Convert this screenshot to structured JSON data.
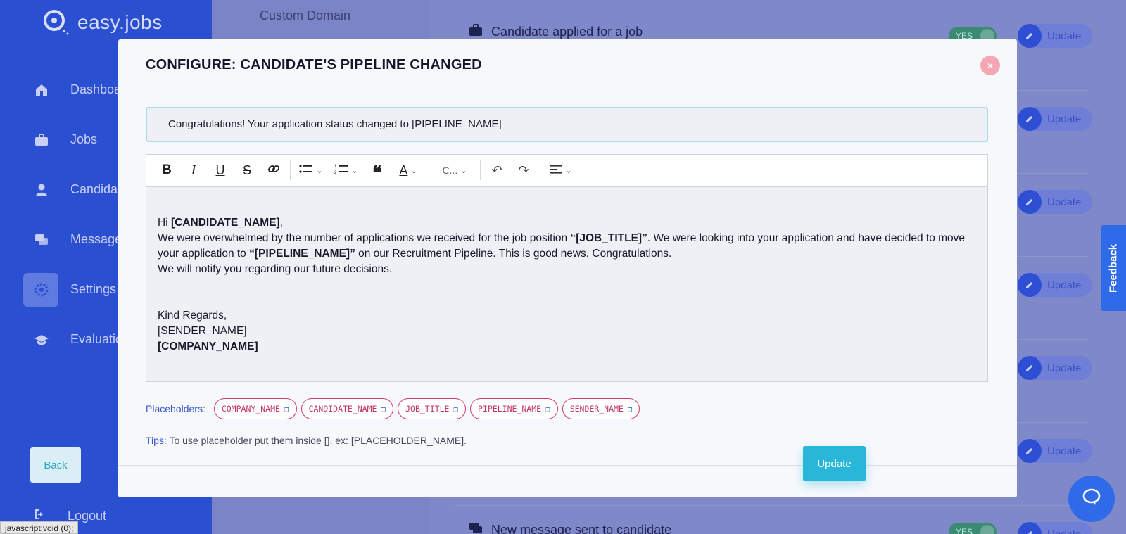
{
  "app": {
    "logo_text": "easy.jobs"
  },
  "sidebar": {
    "items": [
      {
        "label": "Dashboard",
        "icon": "home-icon"
      },
      {
        "label": "Jobs",
        "icon": "briefcase-icon"
      },
      {
        "label": "Candidates",
        "icon": "user-icon"
      },
      {
        "label": "Messages",
        "icon": "chat-icon"
      },
      {
        "label": "Settings",
        "icon": "gear-icon",
        "active": true
      },
      {
        "label": "Evaluation",
        "icon": "graduation-cap-icon"
      }
    ],
    "logout": "Logout"
  },
  "settings_menu": {
    "custom_domain": "Custom Domain"
  },
  "notifications": {
    "rows": [
      {
        "title": "Candidate applied for a job",
        "toggle": "YES",
        "update": "Update"
      },
      {
        "update": "Update"
      },
      {
        "update": "Update"
      },
      {
        "update": "Update"
      },
      {
        "update": "Update"
      },
      {
        "update": "Update"
      },
      {
        "title": "New message sent to candidate",
        "toggle": "YES",
        "update": "Update"
      }
    ]
  },
  "feedback_tab": "Feedback",
  "statusbar": "javascript:void (0);",
  "modal": {
    "title": "CONFIGURE: CANDIDATE'S PIPELINE CHANGED",
    "close": "×",
    "subject": "Congratulations! Your application status changed to [PIPELINE_NAME]",
    "toolbar": {
      "font_family": "C..."
    },
    "body": {
      "greeting_pre": "Hi ",
      "greeting_name": "[CANDIDATE_NAME]",
      "greeting_post": ",",
      "p1_a": "We were overwhelmed by the number of applications we received for the job position ",
      "p1_b": "“[JOB_TITLE]”",
      "p1_c": ". We were looking into your application and have decided to move your application to ",
      "p1_d": "“[PIPELINE_NAME]”",
      "p1_e": " on our Recruitment Pipeline. This is good news, Congratulations.",
      "p2": "We will notify you regarding our future decisions.",
      "regards": "Kind Regards,",
      "sender": "[SENDER_NAME]",
      "company": "[COMPANY_NAME]"
    },
    "placeholders_label": "Placeholders:",
    "placeholders": [
      "COMPANY_NAME",
      "CANDIDATE_NAME",
      "JOB_TITLE",
      "PIPELINE_NAME",
      "SENDER_NAME"
    ],
    "tips_label": "Tips:",
    "tips_text": " To use placeholder put them inside [], ex: [PLACEHOLDER_NAME].",
    "back": "Back",
    "update": "Update"
  },
  "colors": {
    "primary": "#2a4fd0",
    "accent": "#28b6d9",
    "placeholder_chip": "#d13b6a"
  }
}
